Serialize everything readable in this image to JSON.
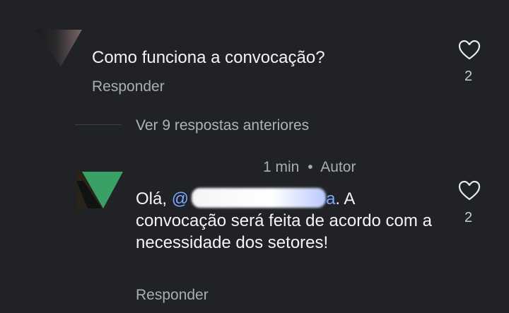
{
  "comment1": {
    "text": "Como funciona a convocação?",
    "reply_label": "Responder",
    "like_count": "2",
    "avatar_icon": "avatar-thumbnail",
    "like_icon": "heart-outline-icon"
  },
  "thread": {
    "view_previous_label": "Ver 9 respostas anteriores"
  },
  "comment2": {
    "meta_time": "1 min",
    "meta_separator": "•",
    "meta_author": "Autor",
    "greeting": "Olá,",
    "mention_prefix": "@",
    "mention_suffix": "a",
    "text_after_mention": ". A convocação será feita de acordo com a necessidade dos setores!",
    "reply_label": "Responder",
    "like_count": "2",
    "avatar_icon": "avatar-thumbnail",
    "like_icon": "heart-outline-icon"
  },
  "colors": {
    "background": "#202226",
    "primary_text": "#f4f4f4",
    "secondary_text": "#a9aeb5",
    "mention": "#7aa7ff"
  }
}
